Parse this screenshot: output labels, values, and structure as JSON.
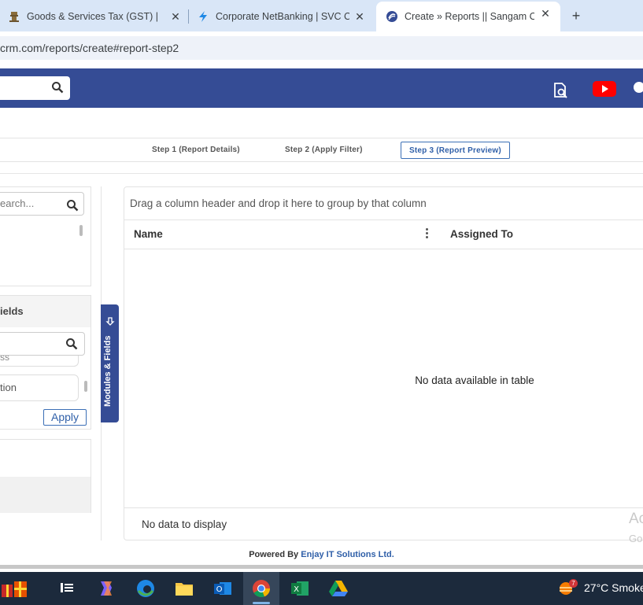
{
  "browser": {
    "tabs": [
      {
        "title": "Goods & Services Tax (GST) | Ho",
        "favicon": "gov-emblem-icon"
      },
      {
        "title": "Corporate NetBanking | SVC CC",
        "favicon": "svc-bank-icon"
      },
      {
        "title": "Create » Reports || Sangam CRM",
        "favicon": "sangam-crm-icon"
      }
    ],
    "close_glyph": "✕",
    "new_tab_glyph": "+",
    "url": "crm.com/reports/create#report-step2"
  },
  "steps": [
    {
      "label": "Step 1 (Report Details)",
      "active": false
    },
    {
      "label": "Step 2 (Apply Filter)",
      "active": false
    },
    {
      "label": "Step 3 (Report Preview)",
      "active": true
    }
  ],
  "left_panel": {
    "search_placeholder": "earch...",
    "section_title": "ields",
    "field_item_1": "ss",
    "field_item_2": "tion",
    "apply_label": "Apply"
  },
  "modules_tab_label": "Modules & Fields",
  "grid": {
    "group_hint": "Drag a column header and drop it here to group by that column",
    "columns": [
      "Name",
      "Assigned To"
    ],
    "empty_message": "No data available in table",
    "footer_message": "No data to display",
    "watermark_line1": "Ac",
    "watermark_line2": "Go"
  },
  "footer": {
    "powered_prefix": "Powered By",
    "company": "Enjay IT Solutions Ltd."
  },
  "taskbar": {
    "notification_count": "7",
    "weather": "27°C  Smoke"
  },
  "colors": {
    "header_blue": "#354c95",
    "accent_blue": "#2f5fa8",
    "tabstrip": "#d9e6f7",
    "taskbar": "#1c2a3c",
    "youtube_red": "#ff0000"
  }
}
